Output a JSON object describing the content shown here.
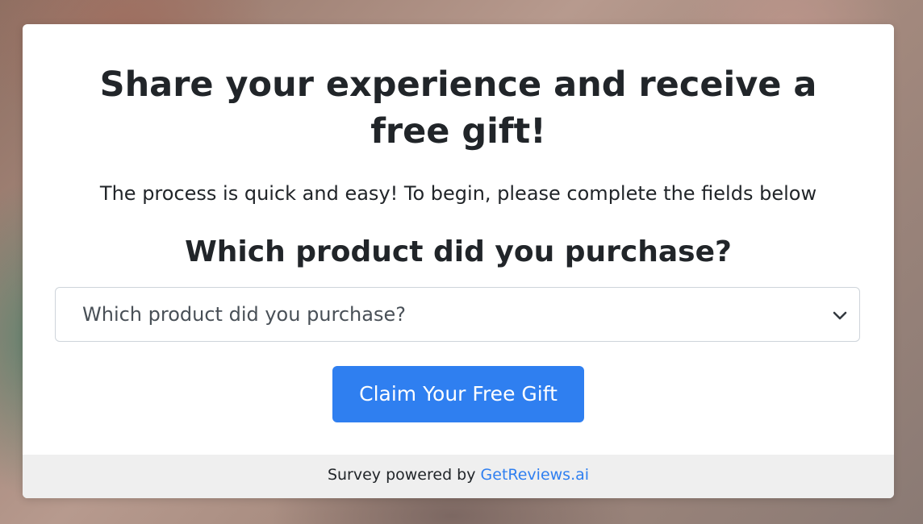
{
  "survey": {
    "title": "Share your experience and receive a free gift!",
    "subtitle": "The process is quick and easy! To begin, please complete the fields below",
    "question": "Which product did you purchase?",
    "product_select": {
      "selected": "Which product did you purchase?"
    },
    "submit_label": "Claim Your Free Gift"
  },
  "footer": {
    "prefix": "Survey powered by ",
    "link_text": "GetReviews.ai"
  },
  "colors": {
    "accent": "#2f7ff0",
    "text": "#212529",
    "footer_bg": "#efefef"
  },
  "icons": {
    "select_caret": "chevron-down-icon"
  }
}
